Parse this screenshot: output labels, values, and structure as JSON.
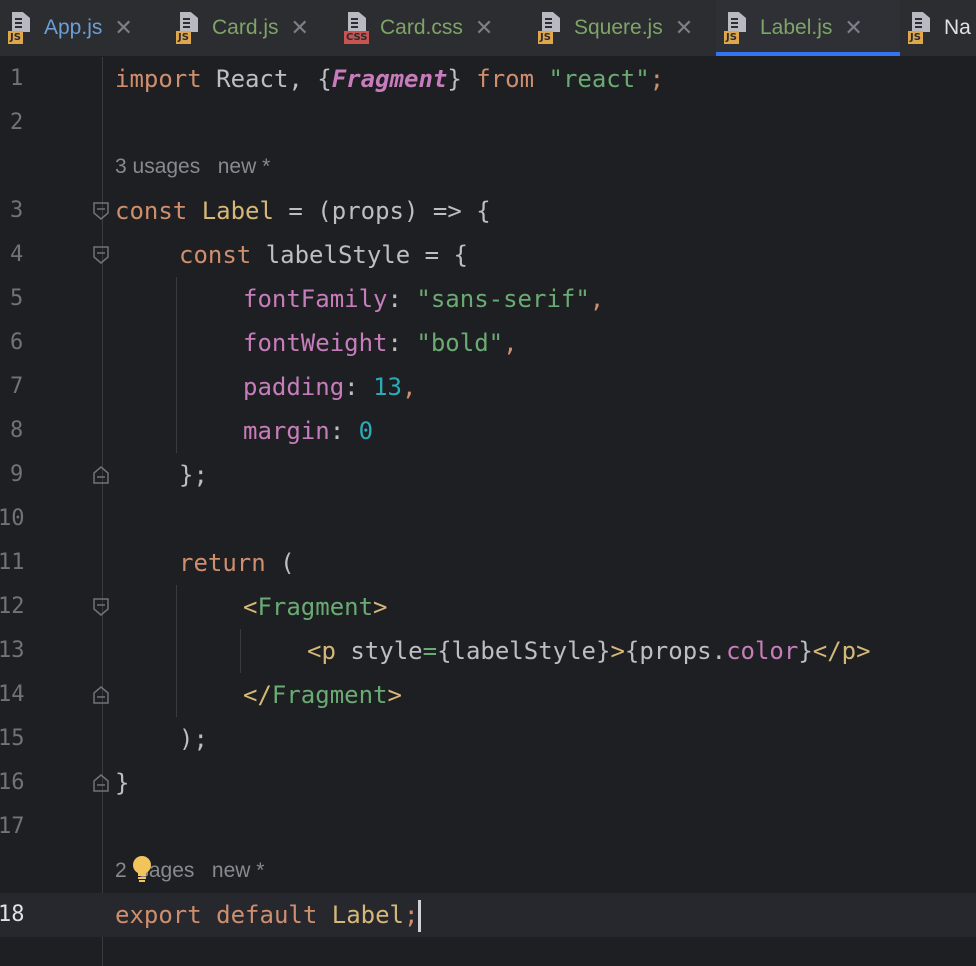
{
  "tabs": [
    {
      "badge": "JS",
      "label": "App.js",
      "active": false,
      "color": "#6a9fd6"
    },
    {
      "badge": "JS",
      "label": "Card.js",
      "active": false,
      "color": "#7fa467"
    },
    {
      "badge": "CSS",
      "label": "Card.css",
      "active": false,
      "color": "#7fa467"
    },
    {
      "badge": "JS",
      "label": "Squere.js",
      "active": false,
      "color": "#7fa467"
    },
    {
      "badge": "JS",
      "label": "Label.js",
      "active": true,
      "color": "#7fa467"
    },
    {
      "badge": "JS",
      "label": "Na",
      "active": false,
      "color": "#dfe1e5"
    }
  ],
  "colors": {
    "js_badge": "#e0a64a",
    "css_badge": "#c75450",
    "accent": "#3574f0"
  },
  "hints": {
    "label_usages": "3 usages",
    "export_usages_num": "2",
    "export_usages_rest": "sages",
    "new_marker": "new *"
  },
  "lines": {
    "l1": "1",
    "l2": "2",
    "l3": "3",
    "l4": "4",
    "l5": "5",
    "l6": "6",
    "l7": "7",
    "l8": "8",
    "l9": "9",
    "l10": "10",
    "l11": "11",
    "l12": "12",
    "l13": "13",
    "l14": "14",
    "l15": "15",
    "l16": "16",
    "l17": "17",
    "l18": "18"
  },
  "code": {
    "import": "import",
    "react": " React, ",
    "brace_open": "{",
    "fragment": "Fragment",
    "brace_close": "}",
    "from": " from ",
    "react_str": "\"react\"",
    "semi": ";",
    "const": "const",
    "label_name": " Label",
    "arrow": " = (props) => {",
    "const2": "const",
    "label_style": " labelStyle = {",
    "font_family": "fontFamily",
    "colon": ": ",
    "sans_serif": "\"sans-serif\"",
    "comma": ",",
    "font_weight": "fontWeight",
    "bold": "\"bold\"",
    "padding": "padding",
    "padding_val": "13",
    "margin": "margin",
    "margin_val": "0",
    "close_obj": "};",
    "return": "return",
    "paren_open": " (",
    "lt": "<",
    "frag_tag": "Fragment",
    "gt": ">",
    "p_open": "<p",
    "style_attr": " style",
    "eq": "=",
    "style_expr": "{labelStyle}",
    "gt2": ">",
    "props_expr_a": "{props.",
    "props_expr_b": "color",
    "props_expr_c": "}",
    "p_close": "</p>",
    "lt_slash": "</",
    "frag_close": "Fragment",
    "gt3": ">",
    "close_paren": ");",
    "close_fn": "}",
    "export": "export",
    "default": " default ",
    "label_export": "Label",
    "semi_end": ";"
  }
}
